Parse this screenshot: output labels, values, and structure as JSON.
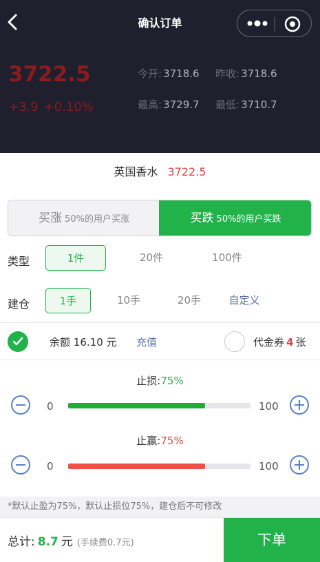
{
  "nav": {
    "title": "确认订单",
    "back_icon": "chevron-left-icon",
    "more_icon": "more-dots-icon",
    "close_icon": "target-circle-icon"
  },
  "quote": {
    "price": "3722.5",
    "change_abs": "+3.9",
    "change_pct": "+0.10%",
    "open_label": "今开:",
    "open": "3718.6",
    "prev_close_label": "昨收:",
    "prev_close": "3718.6",
    "high_label": "最高:",
    "high": "3729.7",
    "low_label": "最低:",
    "low": "3710.7"
  },
  "product": {
    "name": "英国香水",
    "price": "3722.5"
  },
  "direction": {
    "up_label": "买涨",
    "up_sub": "50%的用户买涨",
    "down_label": "买跌",
    "down_sub": "50%的用户买跌",
    "selected": "down"
  },
  "type_row": {
    "label": "类型",
    "options": [
      "1件",
      "20件",
      "100件"
    ],
    "selected_index": 0
  },
  "position_row": {
    "label": "建仓",
    "options": [
      "1手",
      "10手",
      "20手",
      "自定义"
    ],
    "selected_index": 0
  },
  "account": {
    "balance_label": "余额",
    "balance": "16.10 元",
    "recharge_label": "充值",
    "voucher_label": "代金券",
    "voucher_count": "4",
    "voucher_unit": "张"
  },
  "stop_loss": {
    "label": "止损:",
    "percent_text": "75%",
    "min": "0",
    "max": "100",
    "value": 0.75
  },
  "take_profit": {
    "label": "止赢:",
    "percent_text": "75%",
    "min": "0",
    "max": "100",
    "value": 0.75
  },
  "note": "*默认止盈为75%，默认止损位75%，建仓后不可修改",
  "bottom": {
    "total_label": "总计:",
    "total_amount": "8.7",
    "total_unit": "元",
    "fee_text": "(手续费0.7元)",
    "order_label": "下单"
  },
  "colors": {
    "green": "#22b24a",
    "red": "#e04545",
    "dark": "#1f1f2e",
    "link": "#5a6fa8"
  }
}
